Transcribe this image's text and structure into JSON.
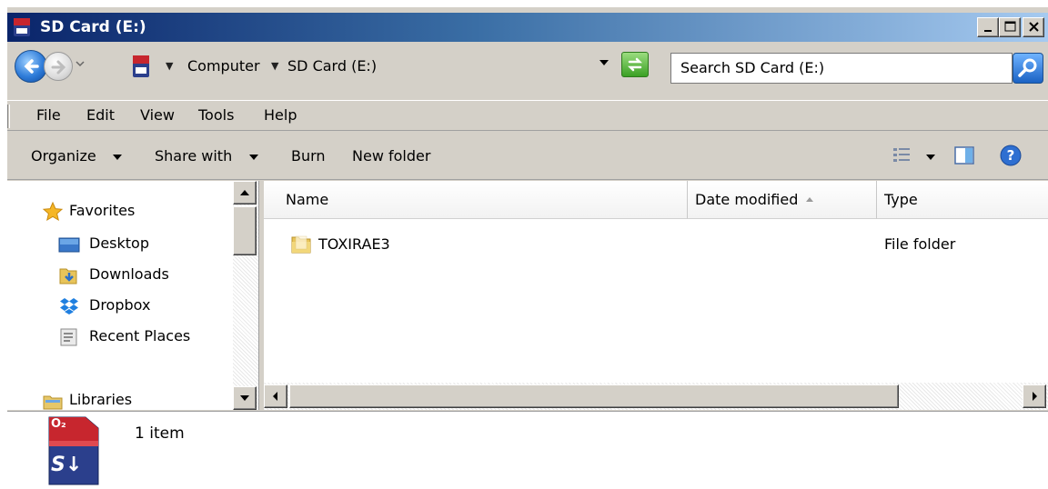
{
  "window": {
    "title": "SD Card (E:)",
    "accent_dark": "#0a246a",
    "accent_light": "#a6caf0"
  },
  "address": {
    "breadcrumbs": [
      "Computer",
      "SD Card (E:)"
    ],
    "search_placeholder": "Search SD Card (E:)"
  },
  "menu": [
    "File",
    "Edit",
    "View",
    "Tools",
    "Help"
  ],
  "commands": {
    "organize": "Organize",
    "share_with": "Share with",
    "burn": "Burn",
    "new_folder": "New folder"
  },
  "navpane": {
    "favorites": "Favorites",
    "items": [
      {
        "label": "Desktop",
        "icon": "desktop-icon"
      },
      {
        "label": "Downloads",
        "icon": "downloads-folder-icon"
      },
      {
        "label": "Dropbox",
        "icon": "dropbox-icon"
      },
      {
        "label": "Recent Places",
        "icon": "recent-places-icon"
      }
    ],
    "libraries": "Libraries"
  },
  "filelist": {
    "columns": [
      "Name",
      "Date modified",
      "Type"
    ],
    "rows": [
      {
        "name": "TOXIRAE3",
        "date_modified": "",
        "type": "File folder",
        "icon": "folder-icon"
      }
    ]
  },
  "details": {
    "item_count": "1 item",
    "card_label": "O₂",
    "card_logo": "S↓"
  }
}
